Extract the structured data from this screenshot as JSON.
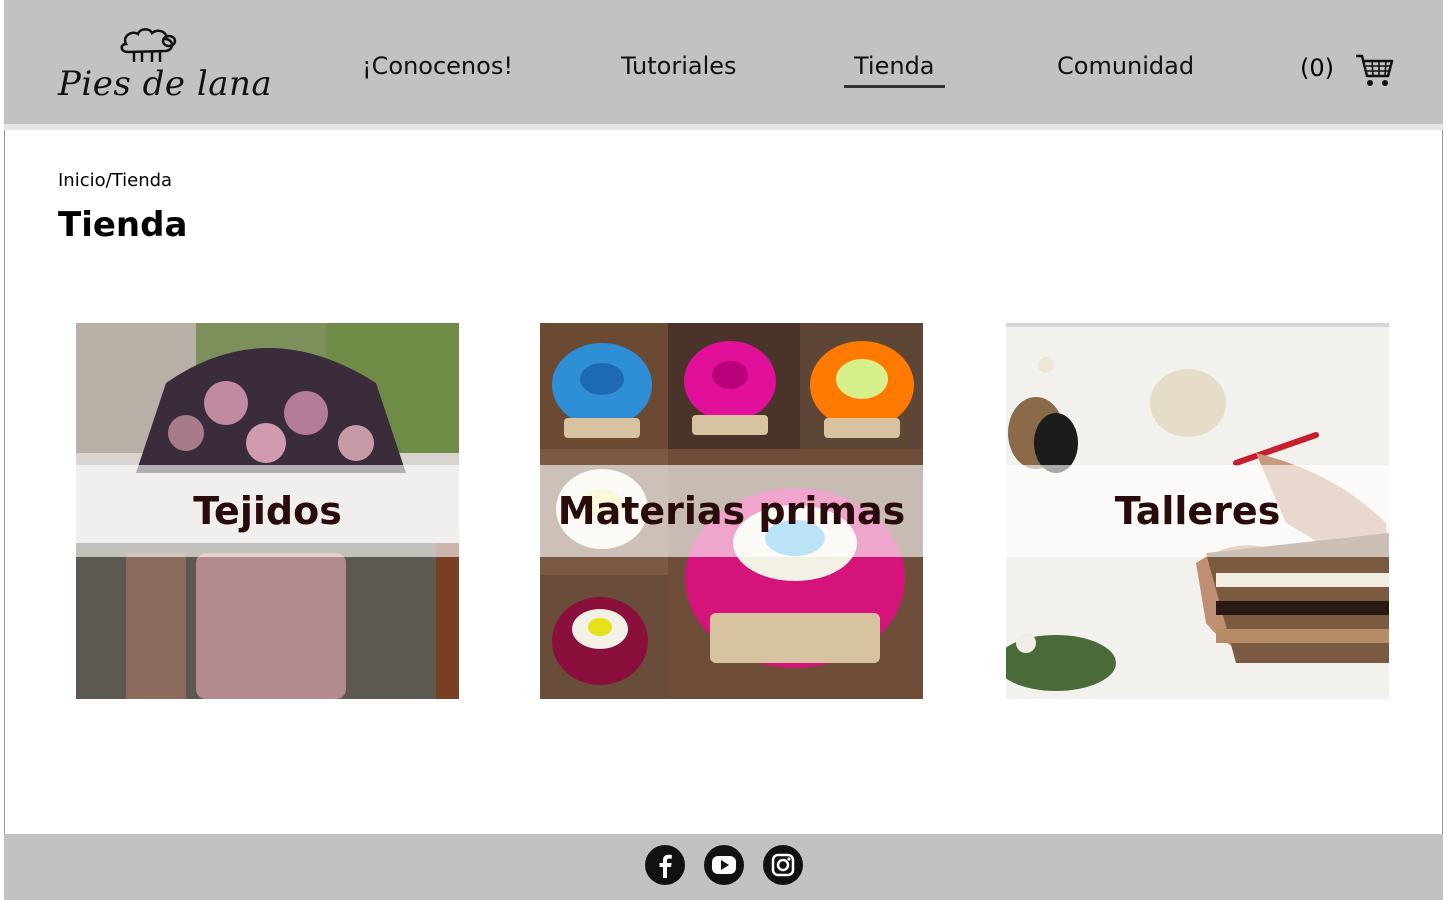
{
  "header": {
    "logo_text": "Pies de lana",
    "nav": [
      {
        "label": "¡Conocenos!"
      },
      {
        "label": "Tutoriales"
      },
      {
        "label": "Tienda"
      },
      {
        "label": "Comunidad"
      }
    ],
    "active_nav": "Tienda",
    "cart_count": "(0)"
  },
  "main": {
    "breadcrumb": "Inicio/Tienda",
    "title": "Tienda",
    "categories": [
      {
        "label": "Tejidos",
        "image": "crochet-top-photo"
      },
      {
        "label": "Materias primas",
        "image": "yarn-cakes-collage"
      },
      {
        "label": "Talleres",
        "image": "hands-crocheting-photo"
      }
    ]
  },
  "footer": {
    "social": [
      "facebook-icon",
      "youtube-icon",
      "instagram-icon"
    ]
  },
  "colors": {
    "header_bg": "#c2c2c2",
    "category_text": "#2a0b0b"
  }
}
